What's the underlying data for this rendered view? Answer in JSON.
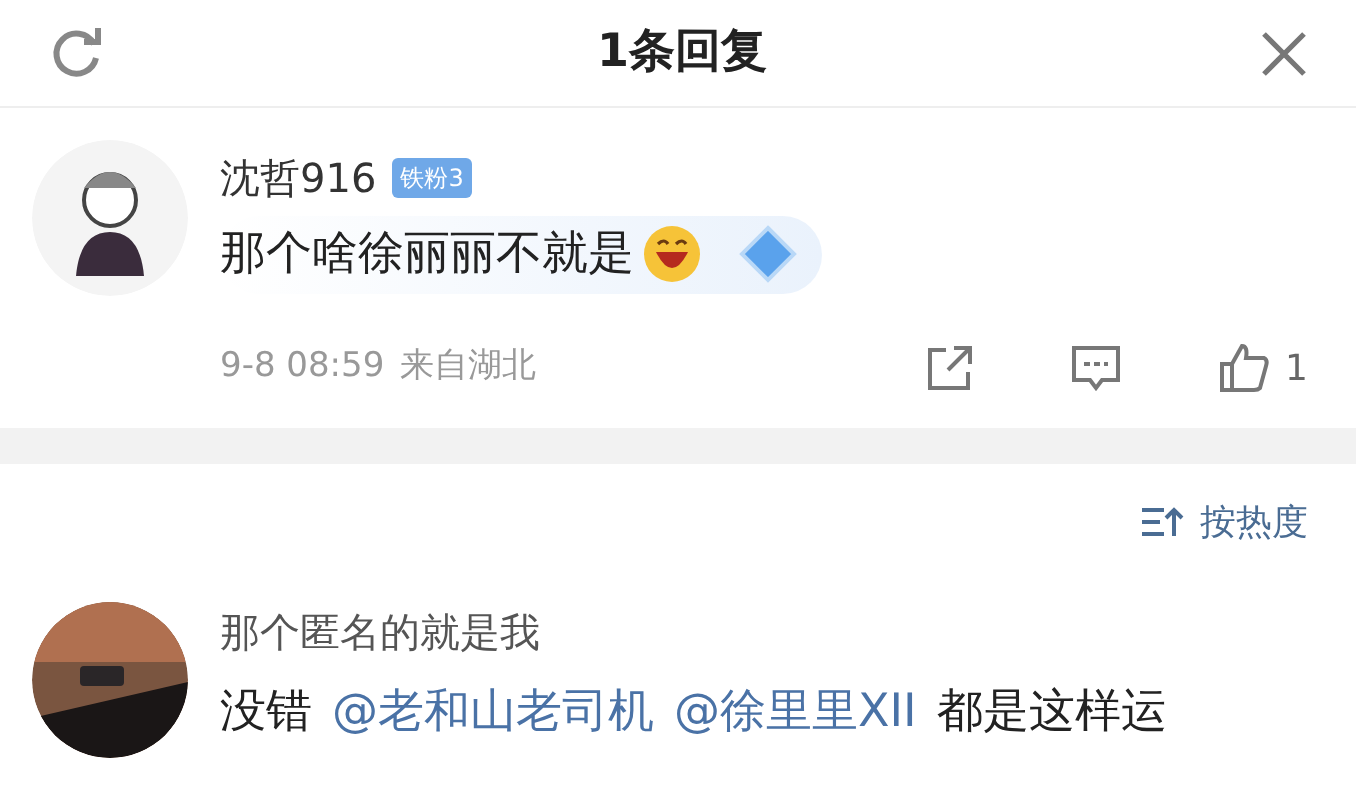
{
  "header": {
    "title": "1条回复"
  },
  "reply": {
    "username": "沈哲916",
    "badge": "铁粉3",
    "text": "那个啥徐丽丽不就是",
    "time": "9-8 08:59",
    "location": "来自湖北",
    "likes": "1"
  },
  "sort": {
    "label": "按热度"
  },
  "comment": {
    "username": "那个匿名的就是我",
    "segments": [
      {
        "kind": "text",
        "text": "没错"
      },
      {
        "kind": "mention",
        "text": "@老和山老司机"
      },
      {
        "kind": "mention",
        "text": "@徐里里XII"
      },
      {
        "kind": "text",
        "text": "都是这样运"
      }
    ]
  }
}
